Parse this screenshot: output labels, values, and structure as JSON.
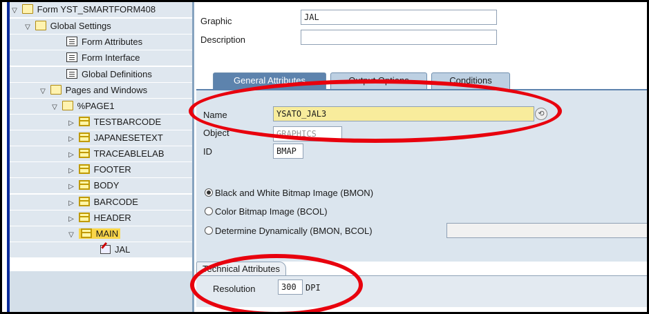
{
  "tree": {
    "root": "Form YST_SMARTFORM408",
    "global_settings": "Global Settings",
    "form_attributes": "Form Attributes",
    "form_interface": "Form Interface",
    "global_definitions": "Global Definitions",
    "pages_windows": "Pages and Windows",
    "page1": "%PAGE1",
    "windows": [
      "TESTBARCODE",
      "JAPANESETEXT",
      "TRACEABLELAB",
      "FOOTER",
      "BODY",
      "BARCODE",
      "HEADER"
    ],
    "main_window": "MAIN",
    "graphic_node": "JAL"
  },
  "header": {
    "graphic_label": "Graphic",
    "graphic_value": "JAL",
    "description_label": "Description",
    "description_value": ""
  },
  "tabs": [
    "General Attributes",
    "Output Options",
    "Conditions"
  ],
  "general": {
    "name_label": "Name",
    "name_value": "YSATO_JAL3",
    "object_label": "Object",
    "object_value": "GRAPHICS",
    "id_label": "ID",
    "id_value": "BMAP",
    "radio_bw": "Black and White Bitmap Image (BMON)",
    "radio_color": "Color Bitmap Image (BCOL)",
    "radio_dynamic": "Determine Dynamically (BMON, BCOL)",
    "dynamic_value": ""
  },
  "technical": {
    "title": "Technical Attributes",
    "resolution_label": "Resolution",
    "resolution_value": "300",
    "unit": "DPI"
  },
  "colors": {
    "annotation": "#e8000d",
    "active_tab": "#5d83ad",
    "panel": "#dbe5ee"
  }
}
